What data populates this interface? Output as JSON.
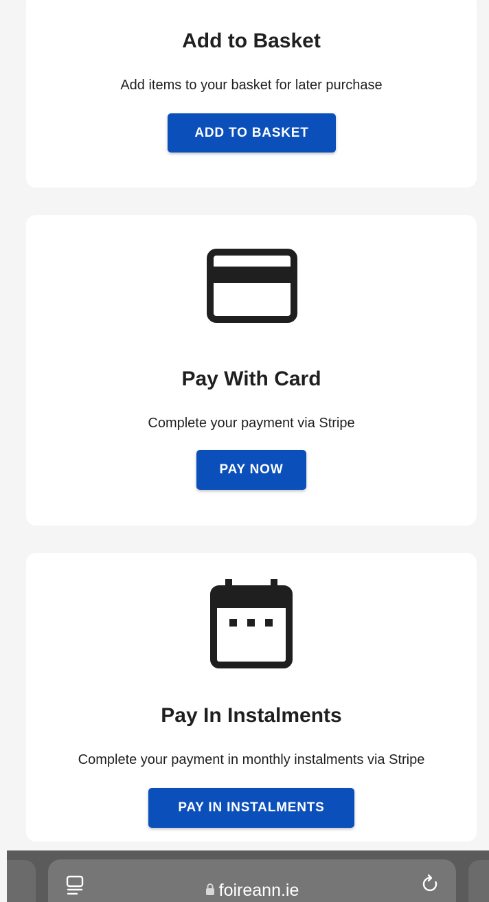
{
  "cards": [
    {
      "title": "Add to Basket",
      "description": "Add items to your basket for later purchase",
      "button_label": "ADD TO BASKET",
      "icon": null
    },
    {
      "title": "Pay With Card",
      "description": "Complete your payment via Stripe",
      "button_label": "PAY NOW",
      "icon": "credit-card-icon"
    },
    {
      "title": "Pay In Instalments",
      "description": "Complete your payment in monthly instalments via Stripe",
      "button_label": "PAY IN INSTALMENTS",
      "icon": "calendar-icon"
    }
  ],
  "browser": {
    "url": "foireann.ie",
    "left_icon": "reader-mode-icon",
    "lock_icon": "lock-icon",
    "right_icon": "reload-icon"
  },
  "colors": {
    "button": "#0b4fbb",
    "page_background": "#f5f5f5",
    "card_background": "#ffffff",
    "browser_bar": "#5b5b5b"
  }
}
